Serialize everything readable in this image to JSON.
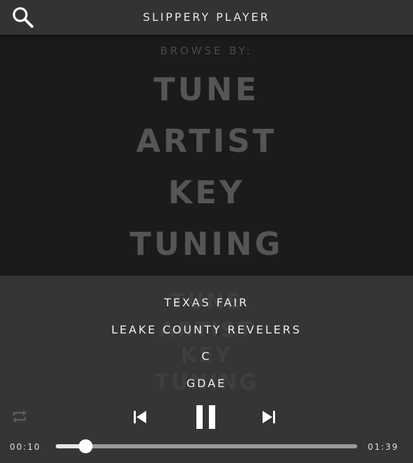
{
  "header": {
    "title": "SLIPPERY PLAYER",
    "search_icon": "search-icon"
  },
  "browse": {
    "label": "BROWSE BY:",
    "items": [
      "TUNE",
      "ARTIST",
      "KEY",
      "TUNING"
    ]
  },
  "now_playing": {
    "title": "TEXAS FAIR",
    "artist": "LEAKE COUNTY REVELERS",
    "key": "C",
    "tuning": "GDAE"
  },
  "controls": {
    "repeat_icon": "repeat-icon",
    "previous_icon": "skip-previous-icon",
    "pause_icon": "pause-icon",
    "next_icon": "skip-next-icon"
  },
  "progress": {
    "current_time": "00:10",
    "total_time": "01:39",
    "fraction": 0.1
  },
  "colors": {
    "header_bg": "#333333",
    "browse_bg": "#1b1b1b",
    "player_bg": "#353535",
    "browse_text": "#555555"
  }
}
